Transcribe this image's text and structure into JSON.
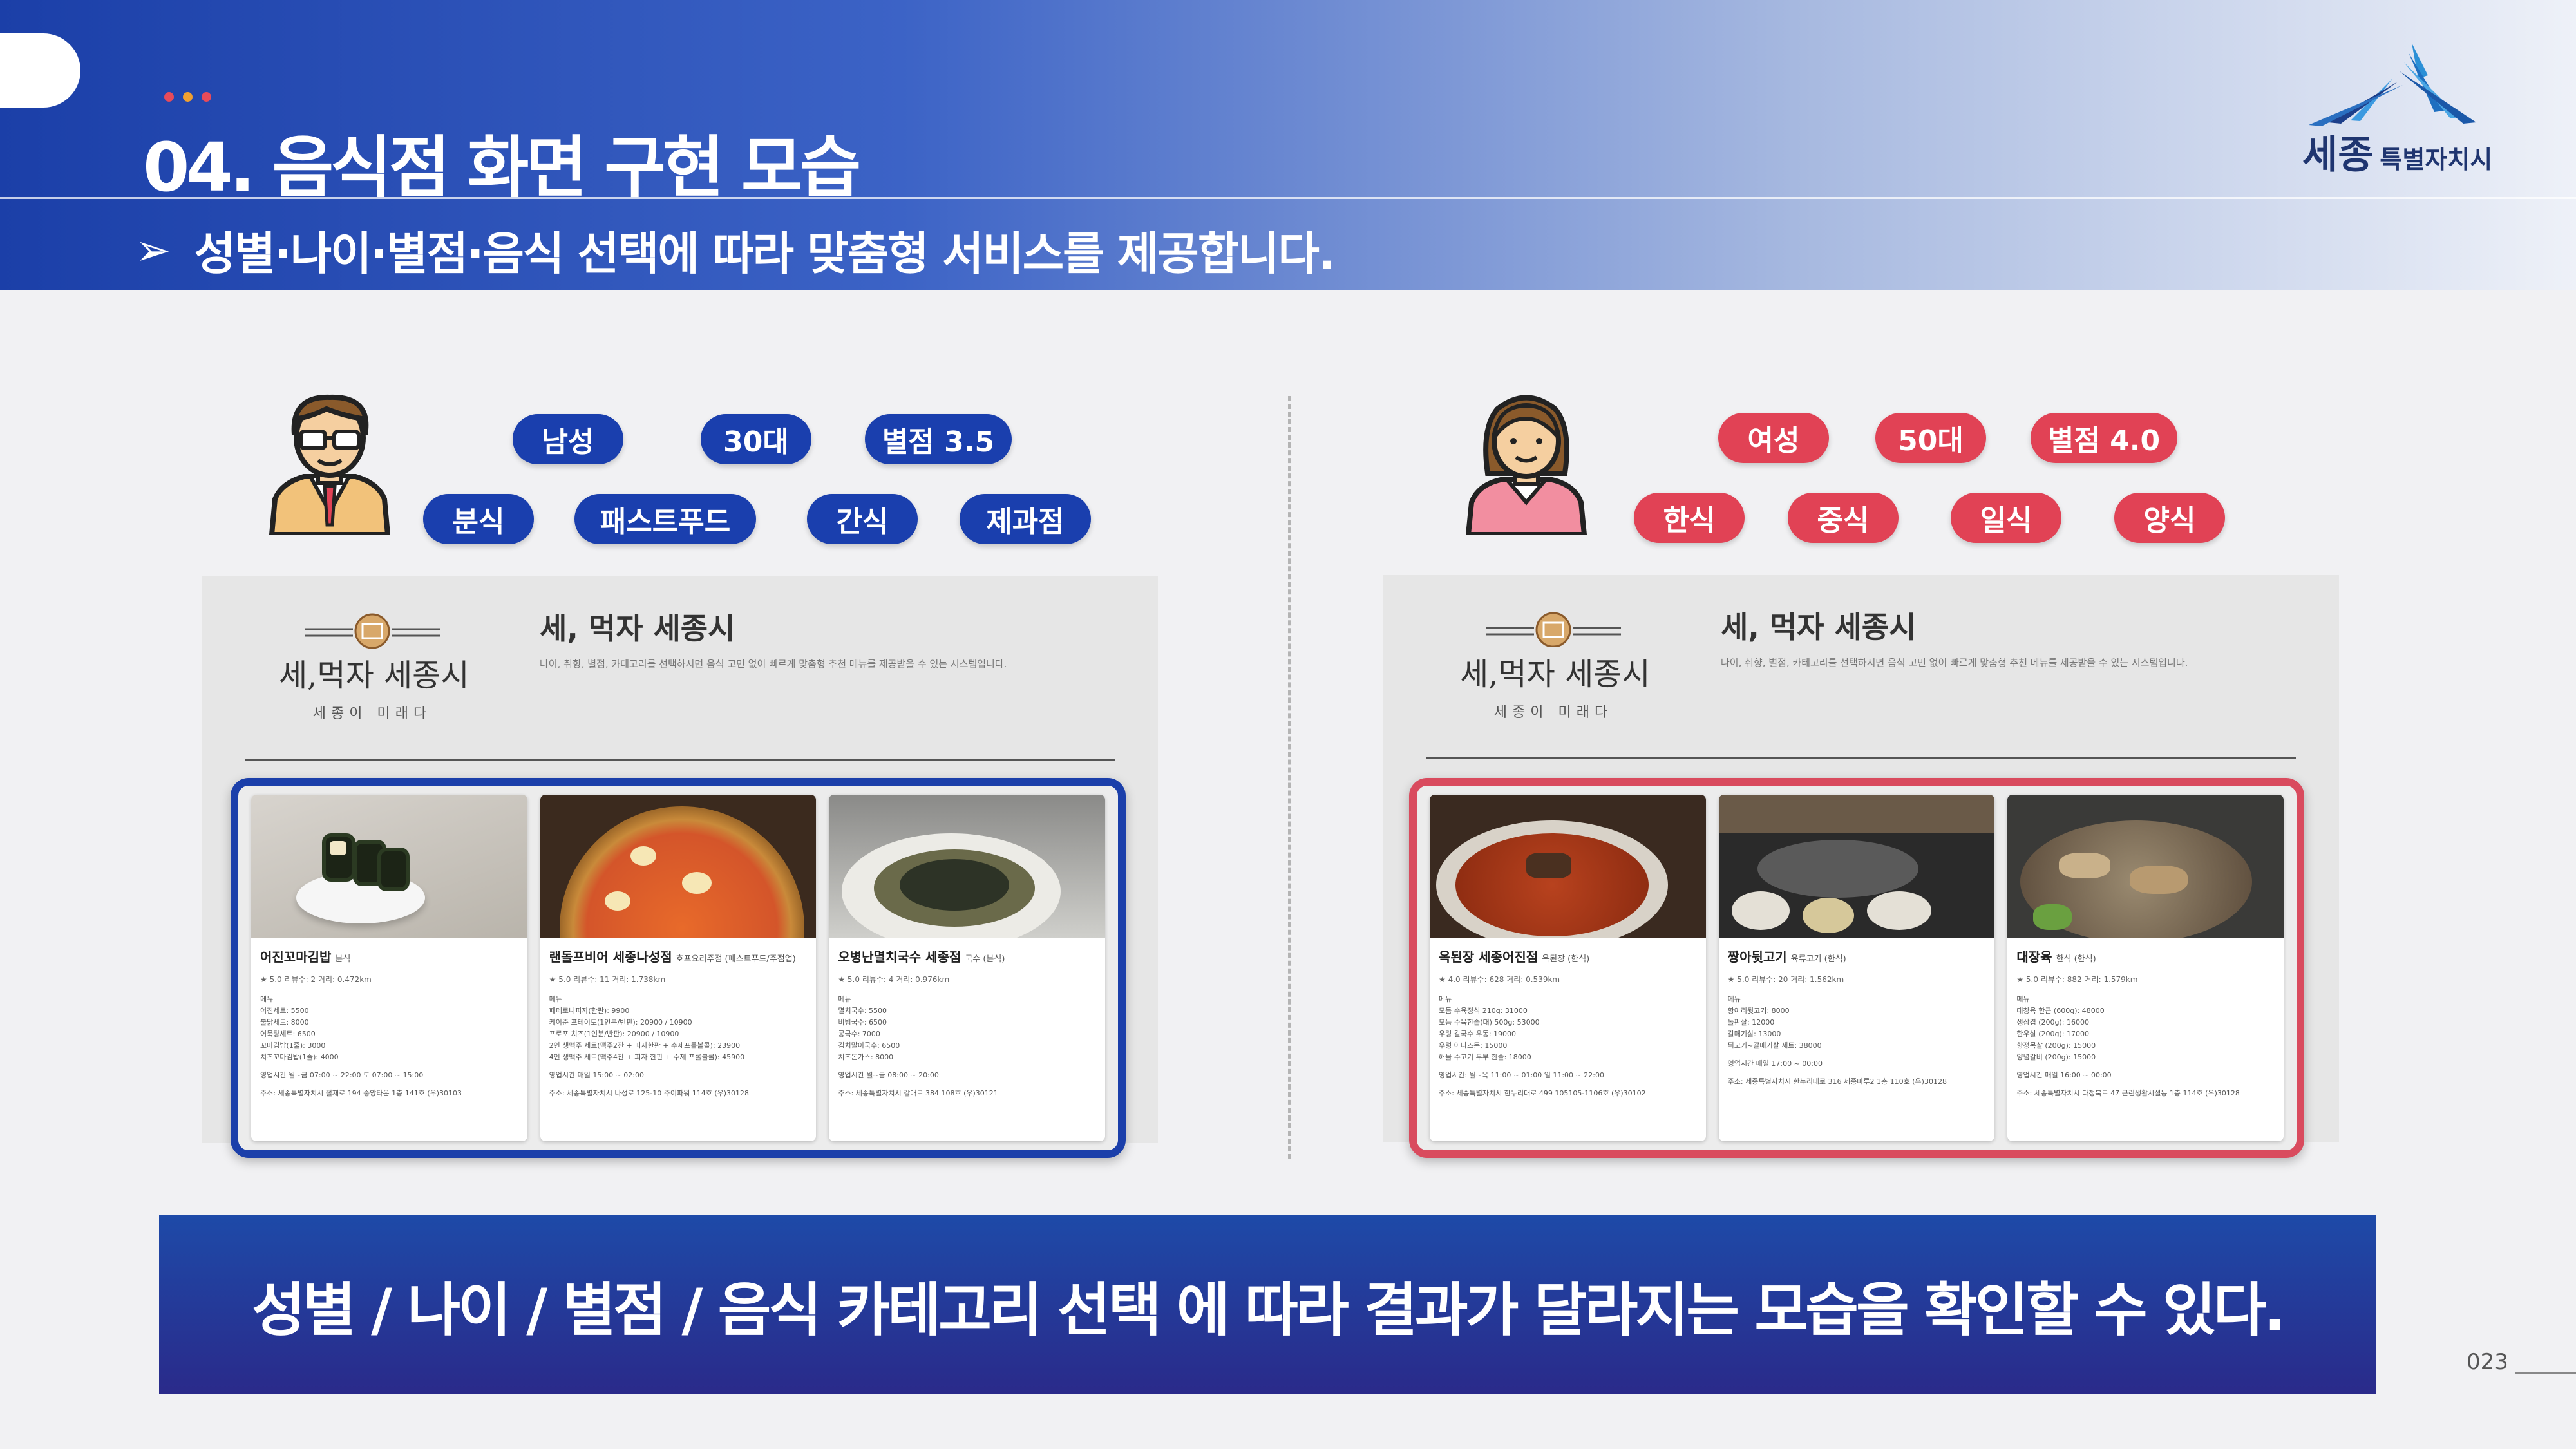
{
  "header": {
    "title": "04. 음식점 화면 구현 모습",
    "subtitle": "성별·나이·별점·음식 선택에 따라 맞춤형 서비스를 제공합니다.",
    "subtitle_icon": "arrow-right-icon",
    "dots": [
      "#e84b5a",
      "#f0a030",
      "#e84b5a"
    ],
    "logo": {
      "brand": "세종",
      "brand_sub": "특별자치시"
    }
  },
  "left_panel": {
    "avatar": "man-avatar-icon",
    "tags_top": [
      "남성",
      "30대",
      "별점 3.5"
    ],
    "tags_bottom": [
      "분식",
      "패스트푸드",
      "간식",
      "제과점"
    ],
    "chip_color": "#1a3fae",
    "app": {
      "title": "세, 먹자 세종시",
      "desc": "나이, 취향, 별점, 카테고리를 선택하시면 음식 고민 없이 빠르게 맞춤형 추천 메뉴를 제공받을 수 있는 시스템입니다.",
      "logo_name": "세,먹자 세종시",
      "logo_sub": "세종이 미래다"
    },
    "cards": [
      {
        "name": "어진꼬마김밥",
        "category": "분식",
        "rating": "★ 5.0 리뷰수: 2 거리: 0.472km",
        "menu": [
          "메뉴",
          "어진세트: 5500",
          "불닭세트: 8000",
          "어묵탕세트: 6500",
          "꼬마김밥(1줄): 3000",
          "치즈꼬마김밥(1줄): 4000"
        ],
        "hours": "영업시간 월~금 07:00 ~ 22:00 토 07:00 ~ 15:00",
        "address": "주소: 세종특별자치시 절재로 194 중앙타운 1층 141호 (우)30103"
      },
      {
        "name": "랜돌프비어 세종나성점",
        "category": "호프요리주점 (패스트푸드/주점업)",
        "rating": "★ 5.0 리뷰수: 11 거리: 1.738km",
        "menu": [
          "메뉴",
          "페페로니피자(한판): 9900",
          "케이준 포테이토(1인분/반판): 20900 / 10900",
          "프로포 치즈(1인분/반판): 20900 / 10900",
          "2인 생맥주 세트(맥주2잔 + 피자한판 + 수제프롤볼콜): 23900",
          "4인 생맥주 세트(맥주4잔 + 피자 한판 + 수제 프롤볼콜): 45900"
        ],
        "hours": "영업시간 매일 15:00 ~ 02:00",
        "address": "주소: 세종특별자치시 나성로 125-10 주이파워 114호 (우)30128"
      },
      {
        "name": "오병난멸치국수 세종점",
        "category": "국수 (분식)",
        "rating": "★ 5.0 리뷰수: 4 거리: 0.976km",
        "menu": [
          "메뉴",
          "멸치국수: 5500",
          "비빔국수: 6500",
          "콩국수: 7000",
          "김치말이국수: 6500",
          "치즈돈가스: 8000"
        ],
        "hours": "영업시간 월~금 08:00 ~ 20:00",
        "address": "주소: 세종특별자치시 갈매로 384 108호 (우)30121"
      }
    ]
  },
  "right_panel": {
    "avatar": "woman-avatar-icon",
    "tags_top": [
      "여성",
      "50대",
      "별점 4.0"
    ],
    "tags_bottom": [
      "한식",
      "중식",
      "일식",
      "양식"
    ],
    "chip_color": "#e14255",
    "app": {
      "title": "세, 먹자 세종시",
      "desc": "나이, 취향, 별점, 카테고리를 선택하시면 음식 고민 없이 빠르게 맞춤형 추천 메뉴를 제공받을 수 있는 시스템입니다.",
      "logo_name": "세,먹자 세종시",
      "logo_sub": "세종이 미래다"
    },
    "cards": [
      {
        "name": "옥된장 세종어진점",
        "category": "옥된장 (한식)",
        "rating": "★ 4.0 리뷰수: 628 거리: 0.539km",
        "menu": [
          "메뉴",
          "모듬 수육정식 210g: 31000",
          "모듬 수육한솥(대) 500g: 53000",
          "우렁 칼국수 우동: 19000",
          "우렁 아나즈돈: 15000",
          "해물 수고기 두부 한솥: 18000"
        ],
        "hours": "영업시간: 월~목 11:00 ~ 01:00 일 11:00 ~ 22:00",
        "address": "주소: 세종특별자치시 한누리대로 499 105105-1106호 (우)30102"
      },
      {
        "name": "짱아뒷고기",
        "category": "육류고기 (한식)",
        "rating": "★ 5.0 리뷰수: 20 거리: 1.562km",
        "menu": [
          "메뉴",
          "항아리뒷고기: 8000",
          "돌판살: 12000",
          "갈매기살: 13000",
          "뒤고기~갈매기살 세트: 38000"
        ],
        "hours": "영업시간 매일 17:00 ~ 00:00",
        "address": "주소: 세종특별자치시 한누리대로 316 세종마루2 1층 110호 (우)30128"
      },
      {
        "name": "대장육",
        "category": "한식 (한식)",
        "rating": "★ 5.0 리뷰수: 882 거리: 1.579km",
        "menu": [
          "메뉴",
          "대창육 한근 (600g): 48000",
          "생삼겹 (200g): 16000",
          "한우살 (200g): 17000",
          "항정목살 (200g): 15000",
          "양념갈비 (200g): 15000"
        ],
        "hours": "영업시간 매일 16:00 ~ 00:00",
        "address": "주소: 세종특별자치시 다정북로 47 근린생활시설동 1층 114호 (우)30128"
      }
    ]
  },
  "banner": {
    "text": "성별 / 나이 / 별점 / 음식  카테고리 선택 에 따라 결과가 달라지는 모습을 확인할 수 있다."
  },
  "page_number": "023"
}
